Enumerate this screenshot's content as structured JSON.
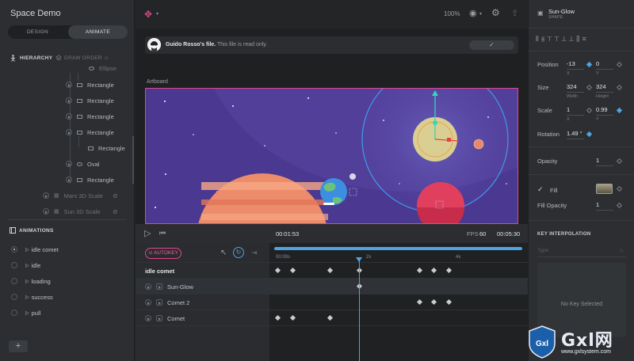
{
  "app": {
    "title": "Space Demo"
  },
  "mode_toggle": {
    "design": "DESIGN",
    "animate": "ANIMATE",
    "active": "animate"
  },
  "hierarchy": {
    "header": "HIERARCHY",
    "draw_order": "DRAW ORDER",
    "items": [
      {
        "label": "Ellipse",
        "icon": "oval-icon",
        "indent": 4
      },
      {
        "label": "Rectangle",
        "icon": "rect-icon",
        "indent": 3
      },
      {
        "label": "Rectangle",
        "icon": "rect-icon",
        "indent": 3
      },
      {
        "label": "Rectangle",
        "icon": "rect-icon",
        "indent": 3
      },
      {
        "label": "Rectangle",
        "icon": "rect-icon",
        "indent": 3
      },
      {
        "label": "Rectangle",
        "icon": "rect-icon",
        "indent": 4
      },
      {
        "label": "Oval",
        "icon": "oval-icon",
        "indent": 3
      },
      {
        "label": "Rectangle",
        "icon": "rect-icon",
        "indent": 3
      },
      {
        "label": "Mars 3D Scale",
        "icon": "group-icon",
        "indent": 1,
        "dim": true
      },
      {
        "label": "Sun 3D Scale",
        "icon": "group-icon",
        "indent": 1,
        "dim": true
      }
    ]
  },
  "animations": {
    "header": "ANIMATIONS",
    "items": [
      {
        "label": "idle comet",
        "selected": true
      },
      {
        "label": "idle",
        "selected": false
      },
      {
        "label": "loading",
        "selected": false
      },
      {
        "label": "success",
        "selected": false
      },
      {
        "label": "pull",
        "selected": false
      }
    ],
    "add_label": "+"
  },
  "topbar": {
    "zoom": "100%"
  },
  "read_only": {
    "owner": "Guido Rosso's file.",
    "message": " This file is read only.",
    "ok_label": "✓"
  },
  "artboard": {
    "label": "Artboard"
  },
  "timeline": {
    "current_time": "00:01:53",
    "fps_label": "FPS",
    "fps": "60",
    "duration": "00:05:30",
    "autokey": "AUTOKEY",
    "ticks": [
      "00:00s",
      "2x",
      "4x"
    ],
    "playhead_fraction": 0.34,
    "animation_name": "idle comet",
    "rows": [
      {
        "label": "Sun-Glow",
        "keys": [
          0.34
        ]
      },
      {
        "label": "Comet 2",
        "keys": [
          0.58,
          0.64,
          0.7
        ]
      },
      {
        "label": "Comet",
        "keys": [
          0.01,
          0.07,
          0.22
        ]
      }
    ],
    "header_keys": [
      0.01,
      0.07,
      0.22,
      0.34,
      0.58,
      0.64,
      0.7
    ]
  },
  "inspector": {
    "object_name": "Sun-Glow",
    "object_type": "SHAPE",
    "position_label": "Position",
    "position_x": "-13",
    "position_y": "0",
    "size_label": "Size",
    "width": "324",
    "height": "324",
    "width_sub": "Width",
    "height_sub": "Height",
    "scale_label": "Scale",
    "scale_x": "1",
    "scale_y": "0.99",
    "x_sub": "X",
    "y_sub": "Y",
    "rotation_label": "Rotation",
    "rotation": "1.49 °",
    "opacity_label": "Opacity",
    "opacity": "1",
    "fill_label": "Fill",
    "fill_color": "#cbbf9d",
    "fill_opacity_label": "Fill Opacity",
    "fill_opacity": "1",
    "key_interp_header": "KEY INTERPOLATION",
    "type_placeholder": "Type",
    "no_key": "No Key Selected"
  },
  "watermark": {
    "brand": "Gxl网",
    "url": "www.gxlsystem.com",
    "badge": "Gxl"
  },
  "colors": {
    "accent": "#4fa3e0",
    "pink": "#e0468c",
    "space": "#4a3a8f"
  }
}
